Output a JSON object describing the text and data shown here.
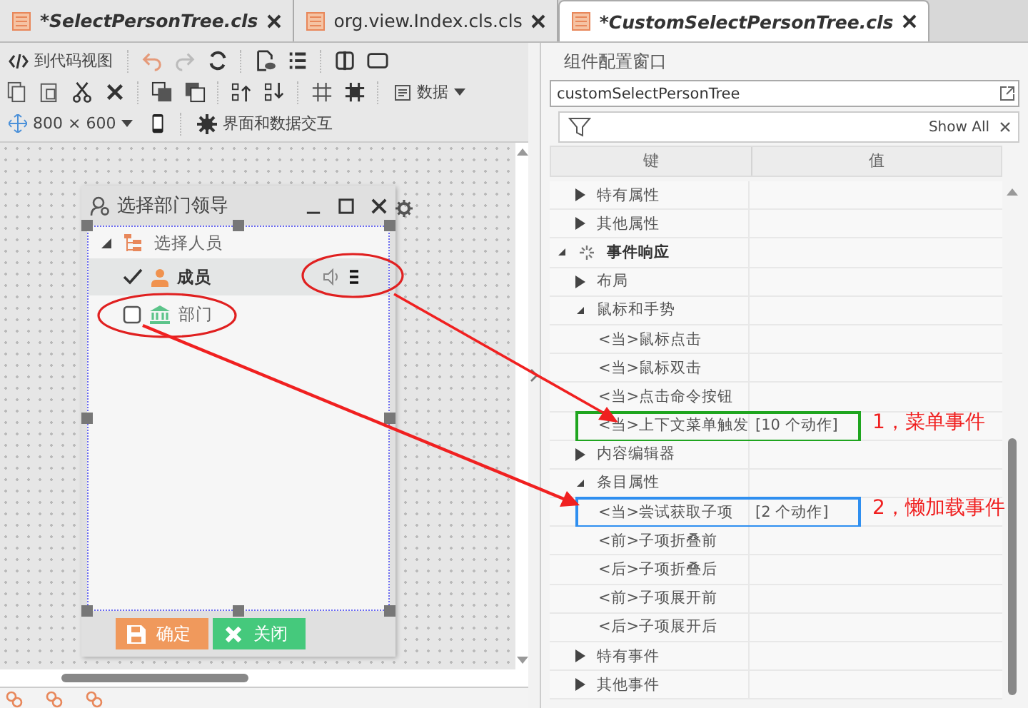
{
  "tabs": [
    {
      "label": "*SelectPersonTree.cls",
      "modified": true,
      "selected": false
    },
    {
      "label": "org.view.Index.cls.cls",
      "modified": false,
      "selected": false
    },
    {
      "label": "*CustomSelectPersonTree.cls",
      "modified": true,
      "selected": true
    }
  ],
  "toolbar": {
    "code_view_button": "到代码视图",
    "data_dropdown": "数据",
    "size_dropdown": "800 × 600",
    "interaction_button": "界面和数据交互"
  },
  "designer_dialog": {
    "title": "选择部门领导",
    "tree": [
      {
        "label": "选择人员",
        "expanded": true,
        "children": [
          {
            "label": "成员",
            "kind": "user",
            "checked": true,
            "selected": true
          },
          {
            "label": "部门",
            "kind": "department",
            "checked": false,
            "selected": false
          }
        ]
      }
    ],
    "buttons": [
      {
        "label": "确定",
        "kind": "save"
      },
      {
        "label": "关闭",
        "kind": "close"
      }
    ]
  },
  "properties": {
    "title": "组件配置窗口",
    "component_name": "customSelectPersonTree",
    "filter_button": "Show All",
    "columns": [
      "键",
      "值"
    ],
    "continued_rows": [
      {
        "label": "特有属性",
        "expanded": false
      },
      {
        "label": "其他属性",
        "expanded": false
      }
    ],
    "tree": [
      {
        "label": "事件响应",
        "expanded": true,
        "children": [
          {
            "label": "布局",
            "expanded": false
          },
          {
            "label": "鼠标和手势",
            "expanded": true,
            "children": [
              {
                "label": "<当>鼠标点击"
              },
              {
                "label": "<当>鼠标双击"
              },
              {
                "label": "<当>点击命令按钮"
              },
              {
                "label": "<当>上下文菜单触发",
                "value": "[10 个动作]",
                "annotation": {
                  "label": "1，菜单事件",
                  "color": "#1fa51f"
                }
              }
            ]
          },
          {
            "label": "内容编辑器",
            "expanded": false
          },
          {
            "label": "条目属性",
            "expanded": true,
            "children": [
              {
                "label": "<当>尝试获取子项",
                "value": "[2 个动作]",
                "annotation": {
                  "label": "2，懒加载事件",
                  "color": "#2f8ff0"
                }
              },
              {
                "label": "<前>子项折叠前"
              },
              {
                "label": "<后>子项折叠后"
              },
              {
                "label": "<前>子项展开前"
              },
              {
                "label": "<后>子项展开后"
              }
            ]
          },
          {
            "label": "特有事件",
            "expanded": false
          },
          {
            "label": "其他事件",
            "expanded": false
          }
        ]
      }
    ]
  }
}
